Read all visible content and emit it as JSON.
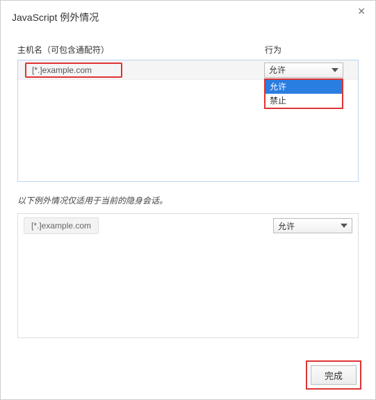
{
  "dialog": {
    "title": "JavaScript 例外情况"
  },
  "headers": {
    "hostname": "主机名（可包含通配符）",
    "behavior": "行为"
  },
  "section1": {
    "row": {
      "host_placeholder": "[*.]example.com",
      "selected_behavior": "允许"
    },
    "options": {
      "allow": "允许",
      "block": "禁止"
    }
  },
  "incognito_note": "以下例外情况仅适用于当前的隐身会话。",
  "section2": {
    "row": {
      "host_placeholder": "[*.]example.com",
      "selected_behavior": "允许"
    }
  },
  "footer": {
    "done": "完成"
  }
}
